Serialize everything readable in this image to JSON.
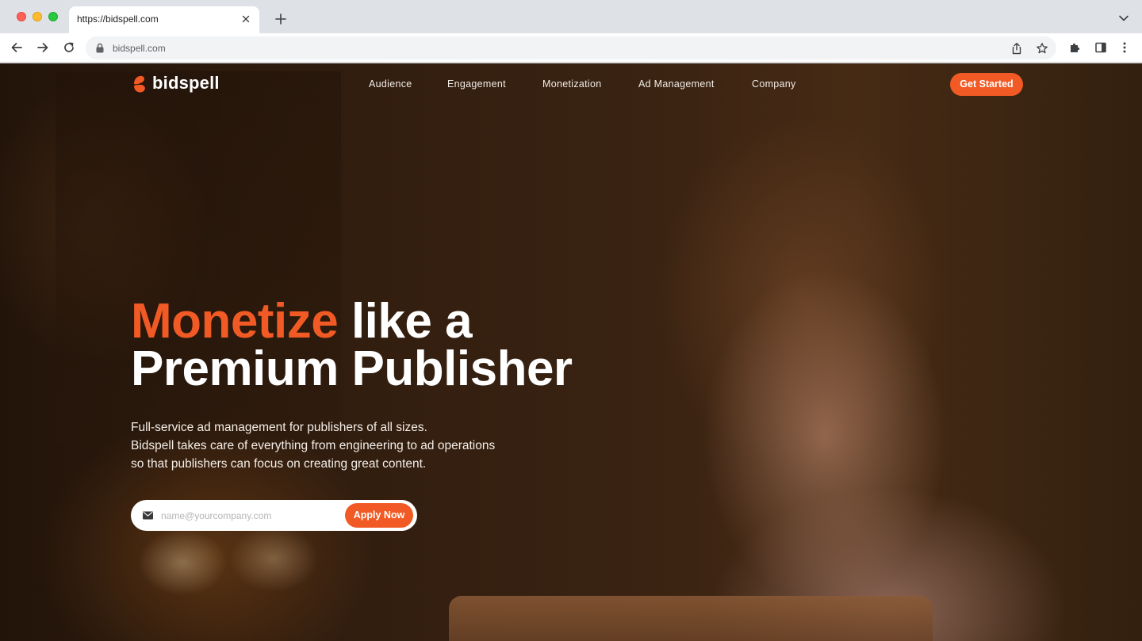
{
  "browser": {
    "tab_title": "https://bidspell.com",
    "url": "bidspell.com"
  },
  "site": {
    "brand": "bidspell",
    "nav": [
      "Audience",
      "Engagement",
      "Monetization",
      "Ad Management",
      "Company"
    ],
    "cta": "Get Started"
  },
  "hero": {
    "headline_accent": "Monetize",
    "headline_rest": " like a",
    "headline_line2": "Premium Publisher",
    "sub_lines": [
      "Full-service ad management for publishers of all sizes.",
      "Bidspell takes care of everything from engineering to ad operations",
      "so that publishers can focus on creating great content."
    ],
    "email_placeholder": "name@yourcompany.com",
    "apply_label": "Apply Now"
  },
  "colors": {
    "accent": "#f15a24",
    "text_light": "#ffffff"
  }
}
